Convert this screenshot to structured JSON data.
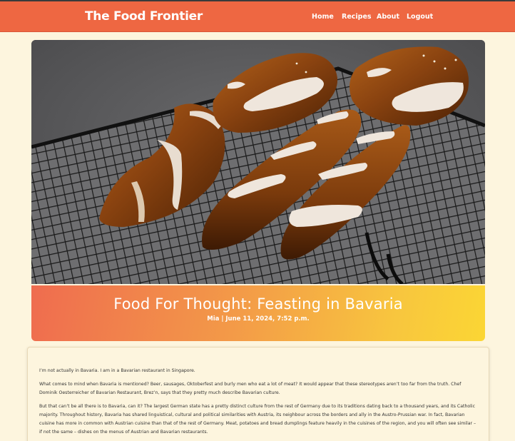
{
  "navbar": {
    "brand": "The Food Frontier",
    "links": [
      {
        "label": "Home"
      },
      {
        "label": "Recipes"
      },
      {
        "label": "About"
      },
      {
        "label": "Logout"
      }
    ]
  },
  "post": {
    "title": "Food For Thought: Feasting in Bavaria",
    "meta": "Mia | June 11, 2024, 7:52 p.m.",
    "paragraphs": [
      "I’m not actually in Bavaria. I am in a Bavarian restaurant in Singapore.",
      "What comes to mind when Bavaria is mentioned? Beer, sausages, Oktoberfest and burly men who eat a lot of meat? It would appear that these stereotypes aren’t too far from the truth. Chef Dominik Oesterreicher of Bavarian Restaurant, Brez’n, says that they pretty much describe Bavarian culture.",
      "But that can’t be all there is to Bavaria, can it? The largest German state has a pretty distinct culture from the rest of Germany due to its traditions dating back to a thousand years, and its Catholic majority. Throughout history, Bavaria has shared linguistical, cultural and political similarities with Austria, its neighbour across the borders and ally in the Austro-Prussian war. In fact, Bavarian cuisine has more in common with Austrian cuisine than that of the rest of Germany. Meat, potatoes and bread dumplings feature heavily in the cuisines of the region, and you will often see similar – if not the same – dishes on the menus of Austrian and Bavarian restaurants."
    ]
  },
  "colors": {
    "navbar": "#ee6742",
    "page_bg": "#fdf5de",
    "gradient_start": "#ef6c4f",
    "gradient_end": "#fbd634"
  },
  "hero_image": {
    "icon": "pretzel-bread-photo"
  }
}
